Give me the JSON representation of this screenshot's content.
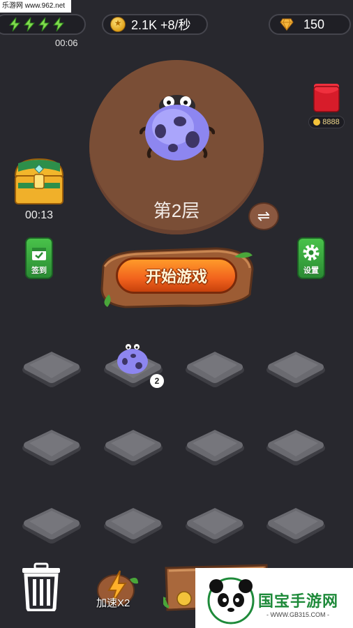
{
  "watermark_top": "乐游网 www.962.net",
  "energy": {
    "bolts": 4,
    "timer": "00:06"
  },
  "coins": {
    "value": "2.1K +8/秒"
  },
  "gems": {
    "value": "150"
  },
  "red_packet": {
    "amount": "8888"
  },
  "chest": {
    "timer": "00:13"
  },
  "main": {
    "floor_label": "第2层"
  },
  "buttons": {
    "signin": "签到",
    "settings": "设置",
    "start": "开始游戏",
    "speed": "加速X2"
  },
  "grid": {
    "rows": 3,
    "cols": 4,
    "occupied": [
      {
        "row": 0,
        "col": 1,
        "level": "2"
      }
    ]
  },
  "watermark_br": {
    "title": "国宝手游网",
    "url": "- WWW.GB315.COM -"
  },
  "colors": {
    "background": "#28282e",
    "plate": "#7a4e36",
    "accent_orange": "#f1621d",
    "accent_green": "#2a8b33"
  }
}
